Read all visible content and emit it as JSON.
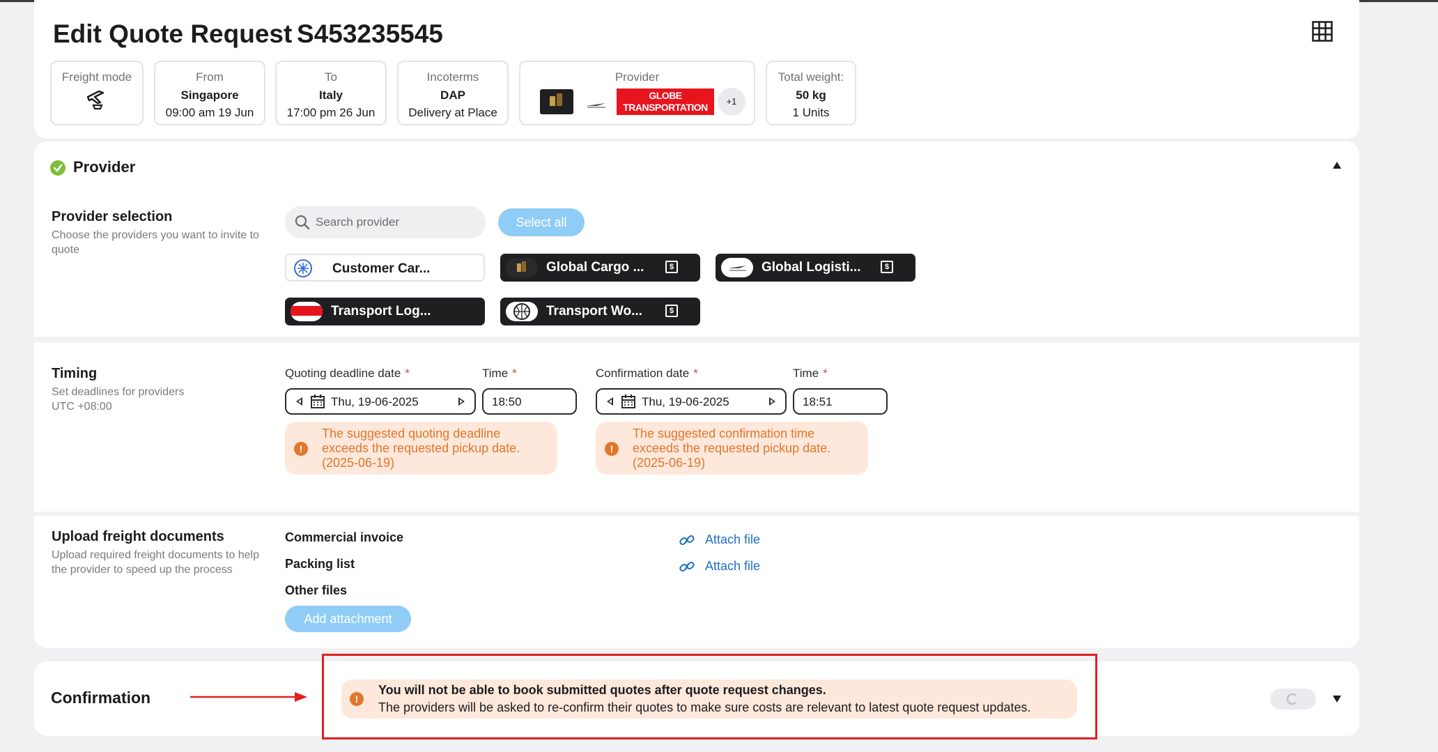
{
  "header": {
    "title": "Edit Quote Request",
    "request_id": "S453235545"
  },
  "summary": {
    "freight_mode": {
      "label": "Freight mode",
      "icon": "air-freight-icon"
    },
    "from": {
      "label": "From",
      "place": "Singapore",
      "time": "09:00 am 19 Jun"
    },
    "to": {
      "label": "To",
      "place": "Italy",
      "time": "17:00 pm 26 Jun"
    },
    "incoterms": {
      "label": "Incoterms",
      "code": "DAP",
      "name": "Delivery at Place"
    },
    "provider": {
      "label": "Provider",
      "logo_text": "GLOBE TRANSPORTATION",
      "more": "+1"
    },
    "weight": {
      "label": "Total weight:",
      "value": "50 kg",
      "units": "1 Units"
    }
  },
  "provider_section": {
    "title": "Provider",
    "selection_title": "Provider selection",
    "selection_desc": "Choose the providers you want to invite to quote",
    "search_placeholder": "Search provider",
    "select_all": "Select all",
    "chips": [
      {
        "name": "Customer Car...",
        "style": "light"
      },
      {
        "name": "Global Cargo ...",
        "style": "dark"
      },
      {
        "name": "Global Logisti...",
        "style": "dark"
      },
      {
        "name": "Transport Log...",
        "style": "dark"
      },
      {
        "name": "Transport Wo...",
        "style": "dark"
      }
    ]
  },
  "timing": {
    "title": "Timing",
    "desc": "Set deadlines for providers",
    "tz": "UTC +08:00",
    "quoting_label": "Quoting deadline date",
    "quoting_date": "Thu, 19-06-2025",
    "time_label": "Time",
    "quoting_time": "18:50",
    "confirm_label": "Confirmation date",
    "confirm_date": "Thu, 19-06-2025",
    "confirm_time": "18:51",
    "required_mark": "*",
    "warn_quoting": "The suggested quoting deadline exceeds the requested pickup date. (2025-06-19)",
    "warn_confirm": "The suggested confirmation time exceeds the requested pickup date. (2025-06-19)"
  },
  "upload": {
    "title": "Upload freight documents",
    "desc": "Upload required freight documents to help the provider to speed up the process",
    "commercial_invoice": "Commercial invoice",
    "packing_list": "Packing list",
    "other_files": "Other files",
    "attach_file": "Attach file",
    "add_attachment": "Add attachment"
  },
  "confirmation": {
    "title": "Confirmation",
    "warning_title": "You will not be able to book submitted quotes after quote request changes.",
    "warning_body": "The providers will be asked to re-confirm their quotes to make sure costs are relevant to latest quote request updates."
  },
  "colors": {
    "accent_blue": "#8fcdf6",
    "warning_orange": "#e0772c",
    "warning_bg": "#fde8db",
    "success_green": "#7cbf3a",
    "annotation_red": "#e02020",
    "link_blue": "#1e6fc0"
  }
}
